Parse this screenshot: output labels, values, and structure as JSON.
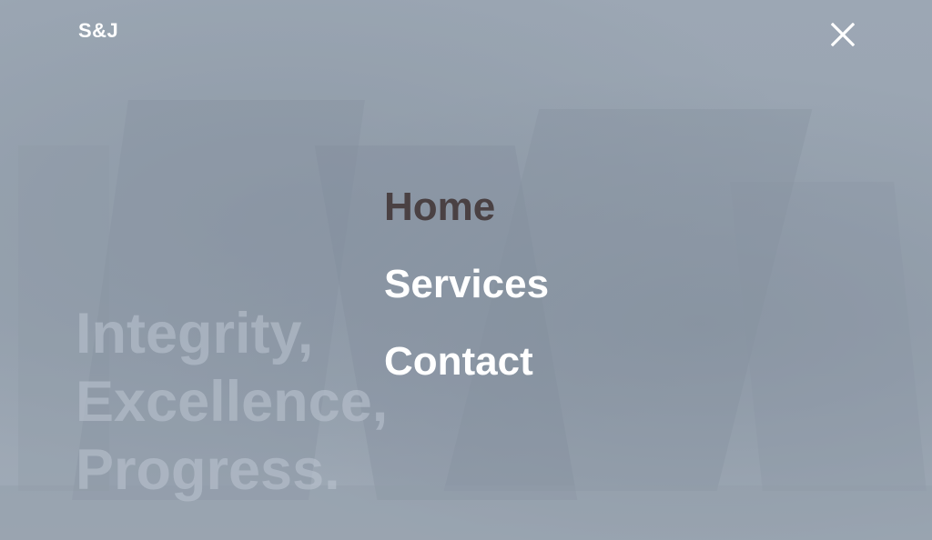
{
  "header": {
    "logo_text": "S&J",
    "close_icon": "close-icon"
  },
  "hero": {
    "lines": [
      "Integrity,",
      "Excellence,",
      "Progress."
    ]
  },
  "menu": {
    "items": [
      {
        "label": "Home",
        "active": true
      },
      {
        "label": "Services",
        "active": false
      },
      {
        "label": "Contact",
        "active": false
      }
    ]
  },
  "colors": {
    "overlay": "#9aa5b1",
    "active_item": "#4a4143",
    "inactive_item": "#ffffff"
  }
}
